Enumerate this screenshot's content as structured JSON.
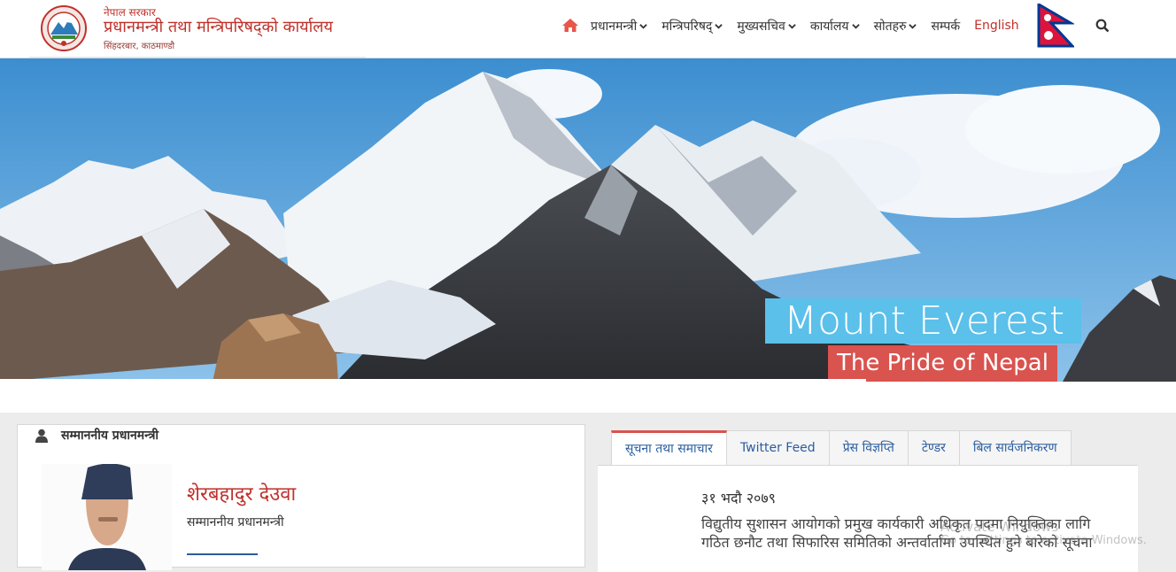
{
  "header": {
    "gov_small": "नेपाल सरकार",
    "office_title": "प्रधानमन्त्री तथा मन्त्रिपरिषद्को कार्यालय",
    "location": "सिंहदरबार, काठमाण्डौ"
  },
  "nav": {
    "items": [
      {
        "label": "प्रधानमन्त्री"
      },
      {
        "label": "मन्त्रिपरिषद्"
      },
      {
        "label": "मुख्यसचिव"
      },
      {
        "label": "कार्यालय"
      },
      {
        "label": "सोतहरु"
      },
      {
        "label": "सम्पर्क"
      }
    ],
    "language": "English"
  },
  "hero": {
    "title": "Mount Everest",
    "subtitle": "The Pride of Nepal"
  },
  "pm": {
    "heading": "सम्माननीय प्रधानमन्त्री",
    "name": "शेरबहादुर देउवा",
    "role": "सम्माननीय प्रधानमन्त्री"
  },
  "tabs": [
    {
      "label": "सूचना तथा समाचार"
    },
    {
      "label": "Twitter Feed"
    },
    {
      "label": "प्रेस विज्ञप्ति"
    },
    {
      "label": "टेण्डर"
    },
    {
      "label": "बिल सार्वजनिकरण"
    }
  ],
  "news": {
    "date": "३१ भदौ २०७९",
    "text": "विद्युतीय सुशासन आयोगको प्रमुख कार्यकारी अधिकृत पदमा नियुक्तिका लागि गठित छनौट तथा सिफारिस समितिको अन्तर्वार्तामा उपस्थित हुने बारेको सूचना"
  },
  "watermark": {
    "line1": "Activate Windows",
    "line2": "Go to Settings to activate Windows."
  },
  "colors": {
    "brand_red": "#c0312b",
    "caption_blue": "#5bc0ea",
    "caption_red": "#d9534f",
    "link_blue": "#2a5d9f"
  }
}
